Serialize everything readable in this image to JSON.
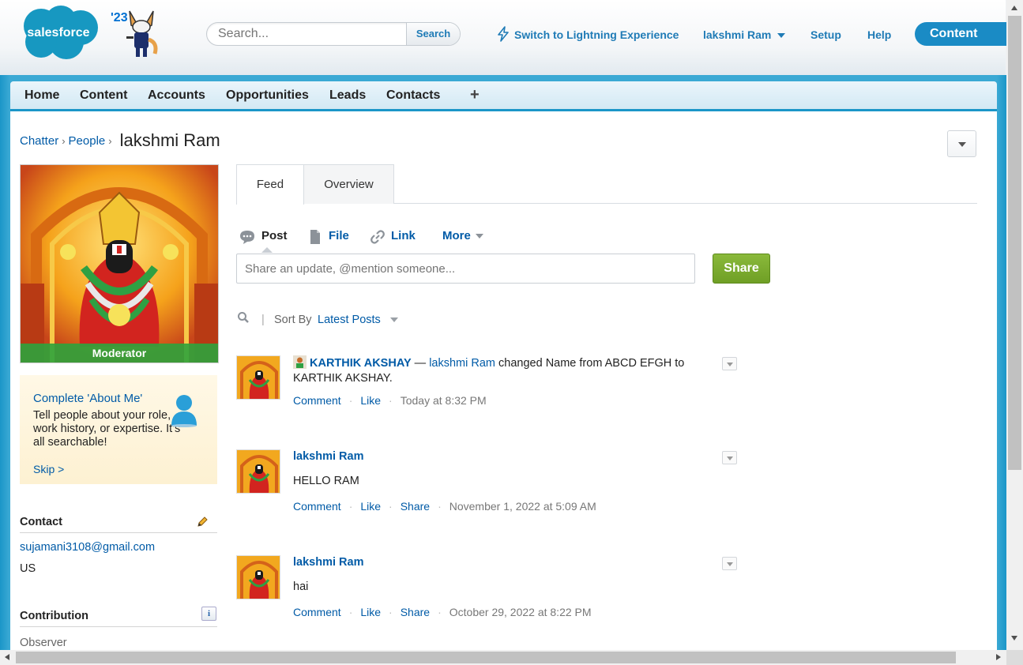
{
  "header": {
    "logo_text": "salesforce",
    "release_badge": "'23",
    "search_placeholder": "Search...",
    "search_button": "Search",
    "lightning_link": "Switch to Lightning Experience",
    "user_menu": "lakshmi Ram",
    "setup_link": "Setup",
    "help_link": "Help",
    "app_name": "Content"
  },
  "tabs": [
    "Home",
    "Content",
    "Accounts",
    "Opportunities",
    "Leads",
    "Contacts"
  ],
  "add_tab": "+",
  "breadcrumb": {
    "chatter": "Chatter",
    "people": "People",
    "current": "lakshmi Ram"
  },
  "profile": {
    "role_badge": "Moderator",
    "about_title": "Complete 'About Me'",
    "about_body": "Tell people about your role, work history, or expertise. It's all searchable!",
    "about_skip": "Skip >",
    "contact_heading": "Contact",
    "email": "sujamani3108@gmail.com",
    "country": "US",
    "contribution_heading": "Contribution",
    "contribution_level": "Observer",
    "info_label": "i"
  },
  "feed_tabs": {
    "feed": "Feed",
    "overview": "Overview"
  },
  "publisher": {
    "post": "Post",
    "file": "File",
    "link": "Link",
    "more": "More",
    "placeholder": "Share an update, @mention someone...",
    "share_button": "Share"
  },
  "sort": {
    "label": "Sort By",
    "value": "Latest Posts"
  },
  "posts": [
    {
      "author": "KARTHIK AKSHAY",
      "separator": "—",
      "target": "lakshmi Ram",
      "text": "changed Name from ABCD EFGH to KARTHIK AKSHAY.",
      "actions": [
        "Comment",
        "Like"
      ],
      "time": "Today at 8:32 PM"
    },
    {
      "author": "lakshmi Ram",
      "text": "HELLO RAM",
      "actions": [
        "Comment",
        "Like",
        "Share"
      ],
      "time": "November 1, 2022 at 5:09 AM"
    },
    {
      "author": "lakshmi Ram",
      "text": "hai",
      "actions": [
        "Comment",
        "Like",
        "Share"
      ],
      "time": "October 29, 2022 at 8:22 PM"
    }
  ],
  "colors": {
    "brand_blue": "#1b96c8",
    "link_blue": "#015ba7",
    "share_green": "#7aab2e",
    "moderator_green": "#2ea33c"
  }
}
